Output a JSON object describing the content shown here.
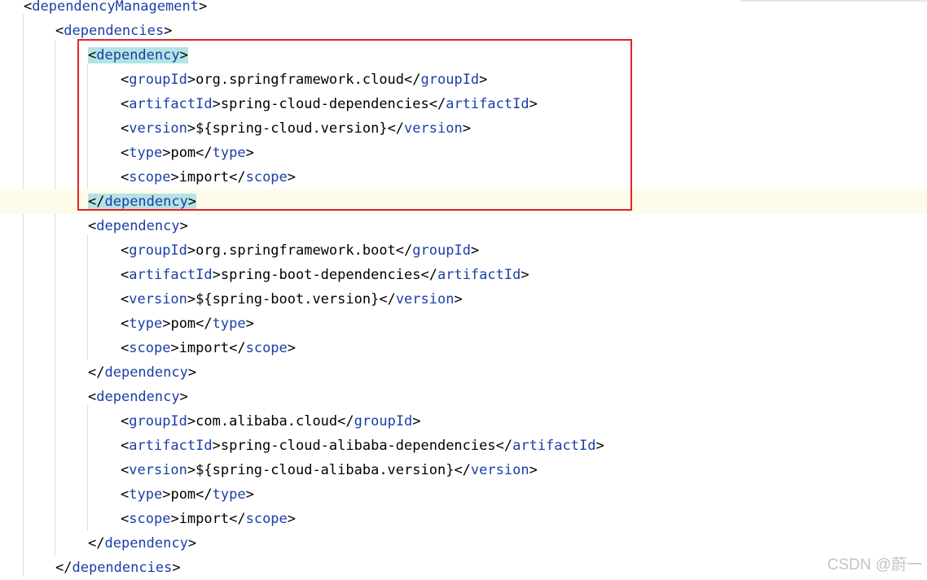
{
  "editor": {
    "lines": [
      {
        "indent": 0,
        "kind": "open",
        "tag": "dependencyManagement"
      },
      {
        "indent": 1,
        "kind": "open",
        "tag": "dependencies"
      },
      {
        "indent": 2,
        "kind": "open",
        "tag": "dependency",
        "bracket_match": true
      },
      {
        "indent": 3,
        "kind": "element",
        "tag": "groupId",
        "value": "org.springframework.cloud"
      },
      {
        "indent": 3,
        "kind": "element",
        "tag": "artifactId",
        "value": "spring-cloud-dependencies"
      },
      {
        "indent": 3,
        "kind": "element",
        "tag": "version",
        "value": "${spring-cloud.version}"
      },
      {
        "indent": 3,
        "kind": "element",
        "tag": "type",
        "value": "pom"
      },
      {
        "indent": 3,
        "kind": "element",
        "tag": "scope",
        "value": "import"
      },
      {
        "indent": 2,
        "kind": "close",
        "tag": "dependency",
        "bracket_match": true,
        "current": true
      },
      {
        "indent": 2,
        "kind": "open",
        "tag": "dependency"
      },
      {
        "indent": 3,
        "kind": "element",
        "tag": "groupId",
        "value": "org.springframework.boot"
      },
      {
        "indent": 3,
        "kind": "element",
        "tag": "artifactId",
        "value": "spring-boot-dependencies"
      },
      {
        "indent": 3,
        "kind": "element",
        "tag": "version",
        "value": "${spring-boot.version}"
      },
      {
        "indent": 3,
        "kind": "element",
        "tag": "type",
        "value": "pom"
      },
      {
        "indent": 3,
        "kind": "element",
        "tag": "scope",
        "value": "import"
      },
      {
        "indent": 2,
        "kind": "close",
        "tag": "dependency"
      },
      {
        "indent": 2,
        "kind": "open",
        "tag": "dependency"
      },
      {
        "indent": 3,
        "kind": "element",
        "tag": "groupId",
        "value": "com.alibaba.cloud"
      },
      {
        "indent": 3,
        "kind": "element",
        "tag": "artifactId",
        "value": "spring-cloud-alibaba-dependencies"
      },
      {
        "indent": 3,
        "kind": "element",
        "tag": "version",
        "value": "${spring-cloud-alibaba.version}"
      },
      {
        "indent": 3,
        "kind": "element",
        "tag": "type",
        "value": "pom"
      },
      {
        "indent": 3,
        "kind": "element",
        "tag": "scope",
        "value": "import"
      },
      {
        "indent": 2,
        "kind": "close",
        "tag": "dependency"
      },
      {
        "indent": 1,
        "kind": "close",
        "tag": "dependencies"
      }
    ]
  },
  "colors": {
    "tag_name": "#1a3ea8",
    "bracket": "#000000",
    "text": "#000000",
    "bracket_match_bg": "#b5e3e3",
    "current_line_bg": "#fdfbea",
    "annotation_box": "#e0242b"
  },
  "watermark": "CSDN @蔚一"
}
